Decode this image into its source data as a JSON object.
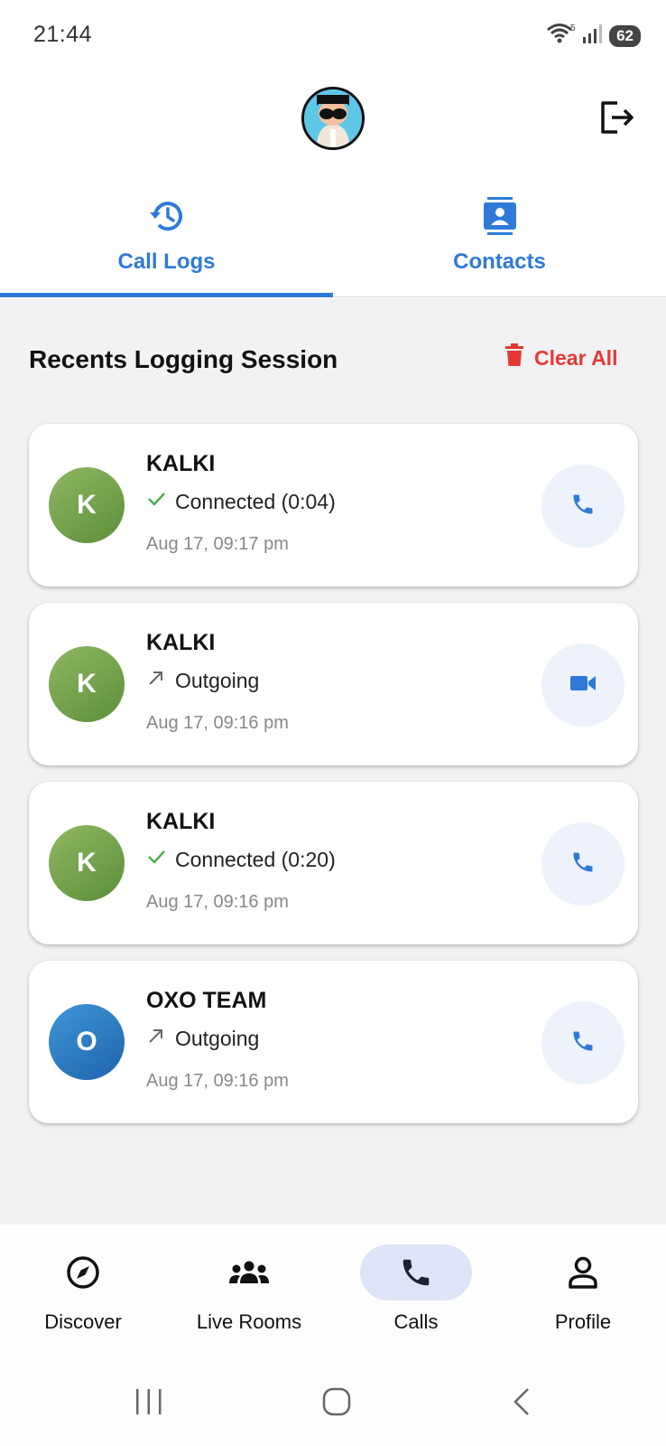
{
  "status_bar": {
    "time": "21:44",
    "battery": "62"
  },
  "tabs": [
    {
      "label": "Call Logs",
      "icon": "history-icon",
      "active": true
    },
    {
      "label": "Contacts",
      "icon": "contact-card-icon",
      "active": false
    }
  ],
  "section": {
    "title": "Recents Logging Session",
    "clear_label": "Clear All"
  },
  "calls": [
    {
      "initial": "K",
      "name": "KALKI",
      "status": "Connected (0:04)",
      "status_icon": "check-icon",
      "time": "Aug 17, 09:17 pm",
      "action_icon": "phone-icon"
    },
    {
      "initial": "K",
      "name": "KALKI",
      "status": "Outgoing",
      "status_icon": "outgoing-arrow-icon",
      "time": "Aug 17, 09:16 pm",
      "action_icon": "video-camera-icon"
    },
    {
      "initial": "K",
      "name": "KALKI",
      "status": "Connected (0:20)",
      "status_icon": "check-icon",
      "time": "Aug 17, 09:16 pm",
      "action_icon": "phone-icon"
    },
    {
      "initial": "O",
      "name": "OXO TEAM",
      "status": "Outgoing",
      "status_icon": "outgoing-arrow-icon",
      "time": "Aug 17, 09:16 pm",
      "action_icon": "phone-icon"
    }
  ],
  "bottom_nav": [
    {
      "label": "Discover",
      "icon": "compass-icon",
      "active": false
    },
    {
      "label": "Live Rooms",
      "icon": "group-icon",
      "active": false
    },
    {
      "label": "Calls",
      "icon": "phone-icon",
      "active": true
    },
    {
      "label": "Profile",
      "icon": "person-icon",
      "active": false
    }
  ],
  "colors": {
    "accent": "#2f7ad8",
    "danger": "#e53935",
    "active_pill": "#dfe5f8"
  }
}
